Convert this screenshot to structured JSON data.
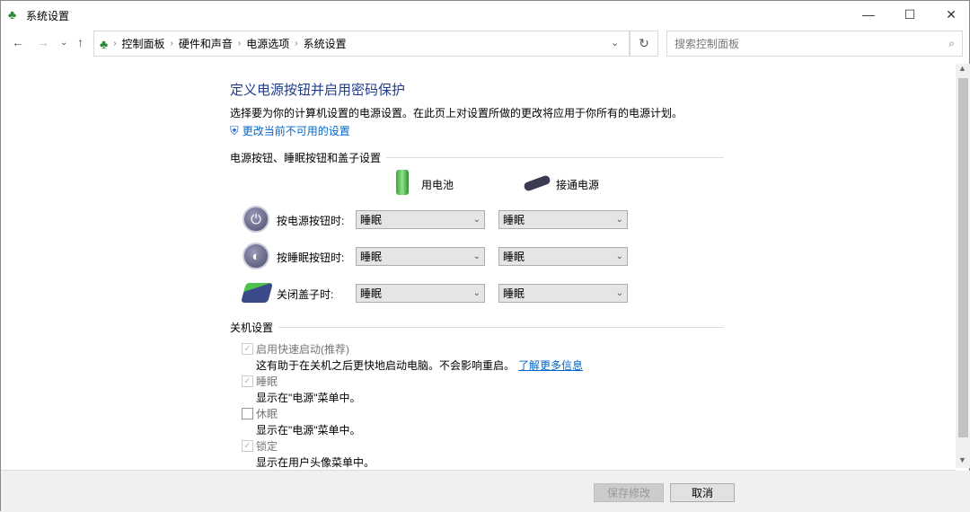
{
  "window": {
    "title": "系统设置"
  },
  "nav": {
    "breadcrumb": [
      "控制面板",
      "硬件和声音",
      "电源选项",
      "系统设置"
    ],
    "search_placeholder": "搜索控制面板"
  },
  "main": {
    "title": "定义电源按钮并启用密码保护",
    "description": "选择要为你的计算机设置的电源设置。在此页上对设置所做的更改将应用于你所有的电源计划。",
    "change_link": "更改当前不可用的设置",
    "buttons_section": {
      "header": "电源按钮、睡眠按钮和盖子设置",
      "columns": [
        "用电池",
        "接通电源"
      ],
      "rows": [
        {
          "label": "按电源按钮时:",
          "battery": "睡眠",
          "plugged": "睡眠"
        },
        {
          "label": "按睡眠按钮时:",
          "battery": "睡眠",
          "plugged": "睡眠"
        },
        {
          "label": "关闭盖子时:",
          "battery": "睡眠",
          "plugged": "睡眠"
        }
      ]
    },
    "shutdown_section": {
      "header": "关机设置",
      "items": [
        {
          "label": "启用快速启动(推荐)",
          "desc": "这有助于在关机之后更快地启动电脑。不会影响重启。",
          "link": "了解更多信息",
          "checked": true
        },
        {
          "label": "睡眠",
          "desc": "显示在\"电源\"菜单中。",
          "checked": true
        },
        {
          "label": "休眠",
          "desc": "显示在\"电源\"菜单中。",
          "checked": false
        },
        {
          "label": "锁定",
          "desc": "显示在用户头像菜单中。",
          "checked": true
        }
      ]
    }
  },
  "footer": {
    "save": "保存修改",
    "cancel": "取消"
  }
}
